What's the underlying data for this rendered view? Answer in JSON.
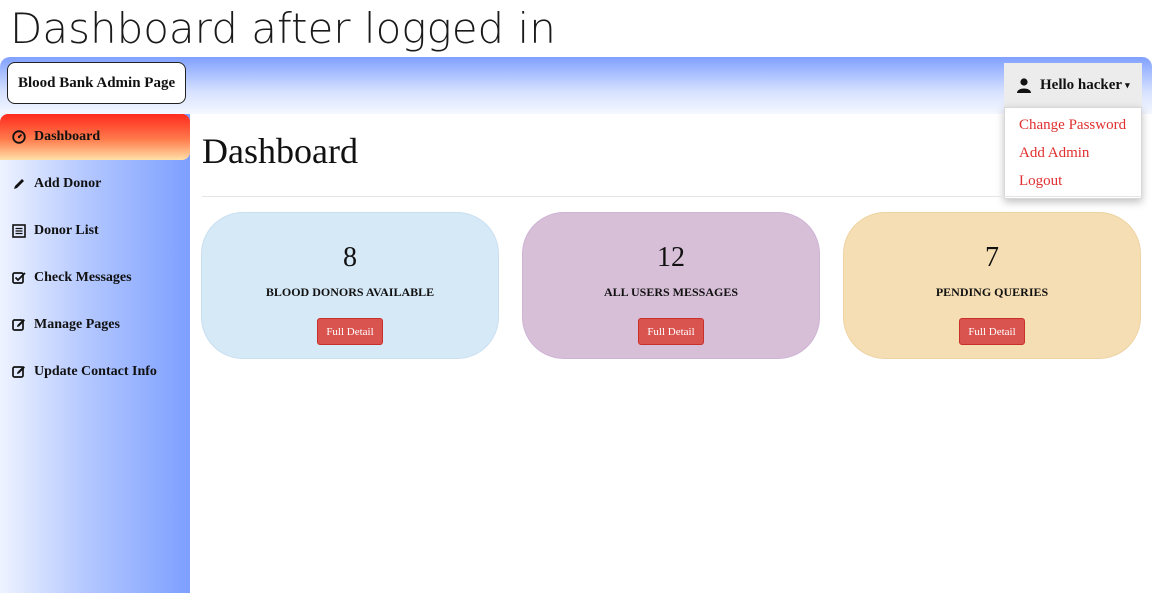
{
  "caption": "Dashboard after logged in",
  "brand": "Blood Bank Admin Page",
  "user": {
    "greeting": "Hello hacker",
    "menu": [
      "Change Password",
      "Add Admin",
      "Logout"
    ],
    "link_color": "#e03030"
  },
  "sidebar": {
    "items": [
      {
        "label": "Dashboard",
        "icon": "dashboard-icon",
        "active": true
      },
      {
        "label": "Add Donor",
        "icon": "pencil-icon",
        "active": false
      },
      {
        "label": "Donor List",
        "icon": "list-icon",
        "active": false
      },
      {
        "label": "Check Messages",
        "icon": "check-square-icon",
        "active": false
      },
      {
        "label": "Manage Pages",
        "icon": "edit-square-icon",
        "active": false
      },
      {
        "label": "Update Contact Info",
        "icon": "edit-square-icon",
        "active": false
      }
    ]
  },
  "main": {
    "title": "Dashboard",
    "cards": [
      {
        "count": "8",
        "label": "BLOOD DONORS AVAILABLE",
        "button": "Full Detail",
        "bg": "#d6e9f7"
      },
      {
        "count": "12",
        "label": "ALL USERS MESSAGES",
        "button": "Full Detail",
        "bg": "#d8bfd8"
      },
      {
        "count": "7",
        "label": "PENDING QUERIES",
        "button": "Full Detail",
        "bg": "#f5deb3"
      }
    ]
  },
  "colors": {
    "button": "#d9534f",
    "active_nav": "#ff2a1e",
    "topbar": "#7fa0ff"
  }
}
